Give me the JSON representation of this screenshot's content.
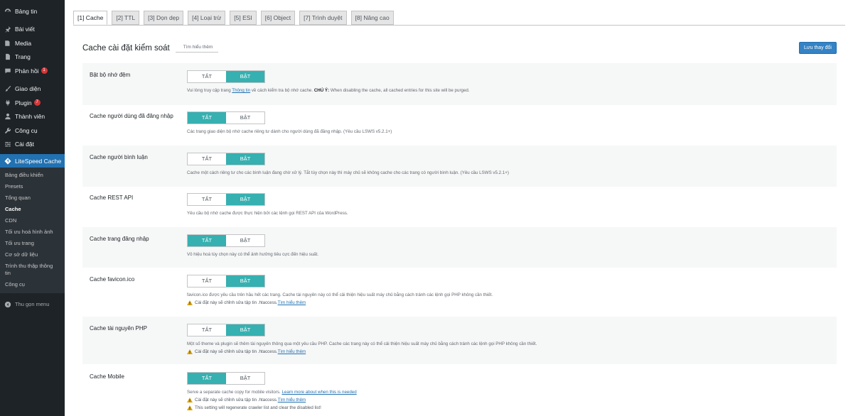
{
  "sidebar": {
    "items": [
      {
        "label": "Bảng tin",
        "icon": "dashboard-icon"
      },
      {
        "label": "Bài viết",
        "icon": "pin-icon"
      },
      {
        "label": "Media",
        "icon": "media-icon"
      },
      {
        "label": "Trang",
        "icon": "page-icon"
      },
      {
        "label": "Phản hồi",
        "icon": "comment-icon",
        "badge": "1"
      },
      {
        "label": "Giao diện",
        "icon": "brush-icon"
      },
      {
        "label": "Plugin",
        "icon": "plugin-icon",
        "badge": "7"
      },
      {
        "label": "Thành viên",
        "icon": "user-icon"
      },
      {
        "label": "Công cụ",
        "icon": "wrench-icon"
      },
      {
        "label": "Cài đặt",
        "icon": "settings-icon"
      }
    ],
    "active": {
      "label": "LiteSpeed Cache",
      "icon": "litespeed-icon"
    },
    "submenu": [
      "Bảng điều khiển",
      "Presets",
      "Tổng quan",
      "Cache",
      "CDN",
      "Tối ưu hoá hình ảnh",
      "Tối ưu trang",
      "Cơ sở dữ liệu",
      "Trình thu thập thông tin",
      "Công cụ"
    ],
    "submenu_current": "Cache",
    "collapse_label": "Thu gọn menu"
  },
  "tabs": [
    "[1] Cache",
    "[2] TTL",
    "[3] Dọn dẹp",
    "[4] Loại trừ",
    "[5] ESI",
    "[6] Object",
    "[7] Trình duyệt",
    "[8] Nâng cao"
  ],
  "active_tab": "[1] Cache",
  "header": {
    "title": "Cache cài đặt kiểm soát",
    "learn_more": "Tìm hiểu thêm",
    "save_label": "Lưu thay đổi"
  },
  "toggle_labels": {
    "off": "TẮT",
    "on": "BẬT"
  },
  "settings": [
    {
      "label": "Bật bộ nhớ đệm",
      "state": "on",
      "desc": {
        "pre": "Vui lòng truy cập trang ",
        "link": "Thông tin",
        "mid": " về cách kiểm tra bộ nhớ cache. ",
        "bold": "CHÚ Ý:",
        "post": " When disabling the cache, all cached entries for this site will be purged."
      },
      "warnings": []
    },
    {
      "label": "Cache người dùng đã đăng nhập",
      "state": "off",
      "desc": {
        "pre": "Các trang giao diện bộ nhớ cache riêng tư dành cho người dùng đã đăng nhập. (Yêu cầu LSWS v5.2.1+)"
      },
      "warnings": []
    },
    {
      "label": "Cache người bình luận",
      "state": "on",
      "desc": {
        "pre": "Cache một cách riêng tư cho các bình luận đang chờ xử lý. Tắt tùy chọn này thì máy chủ sẽ không cache cho các trang có người bình luận. (Yêu cầu LSWS v5.2.1+)"
      },
      "warnings": []
    },
    {
      "label": "Cache REST API",
      "state": "on",
      "desc": {
        "pre": "Yêu cầu bộ nhớ cache được thực hiện bởi các lệnh gọi REST API của WordPress."
      },
      "warnings": []
    },
    {
      "label": "Cache trang đăng nhập",
      "state": "off",
      "desc": {
        "pre": "Vô hiệu hoá tùy chọn này có thể ảnh hưởng tiêu cực đến hiệu suất."
      },
      "warnings": []
    },
    {
      "label": "Cache favicon.ico",
      "state": "on",
      "desc": {
        "pre": "favicon.ico được yêu cầu trên hầu hết các trang. Cache tài nguyên này có thể cải thiện hiệu suất máy chủ bằng cách tránh các lệnh gọi PHP không cần thiết."
      },
      "warnings": [
        {
          "text": "Cài đặt này sẽ chỉnh sửa tập tin .htaccess. ",
          "link": "Tìm hiểu thêm"
        }
      ]
    },
    {
      "label": "Cache tài nguyên PHP",
      "state": "on",
      "desc": {
        "pre": "Một số theme và plugin sẽ thêm tài nguyên thông qua một yêu cầu PHP. Cache các trang này có thể cải thiện hiệu suất máy chủ bằng cách tránh các lệnh gọi PHP không cần thiết."
      },
      "warnings": [
        {
          "text": "Cài đặt này sẽ chỉnh sửa tập tin .htaccess. ",
          "link": "Tìm hiểu thêm"
        }
      ]
    },
    {
      "label": "Cache Mobile",
      "state": "off",
      "desc": {
        "pre": "Serve a separate cache copy for mobile visitors. ",
        "link": "Learn more about when this is needed"
      },
      "warnings": [
        {
          "text": "Cài đặt này sẽ chỉnh sửa tập tin .htaccess. ",
          "link": "Tìm hiểu thêm"
        },
        {
          "text": "This setting will regenerate crawler list and clear the disabled list!",
          "link": ""
        }
      ]
    }
  ],
  "colors": {
    "sidebar_bg": "#1d2327",
    "active_menu": "#2271b1",
    "toggle_on": "#36b0b0",
    "save_button": "#3582c4",
    "warning": "#dba617"
  }
}
